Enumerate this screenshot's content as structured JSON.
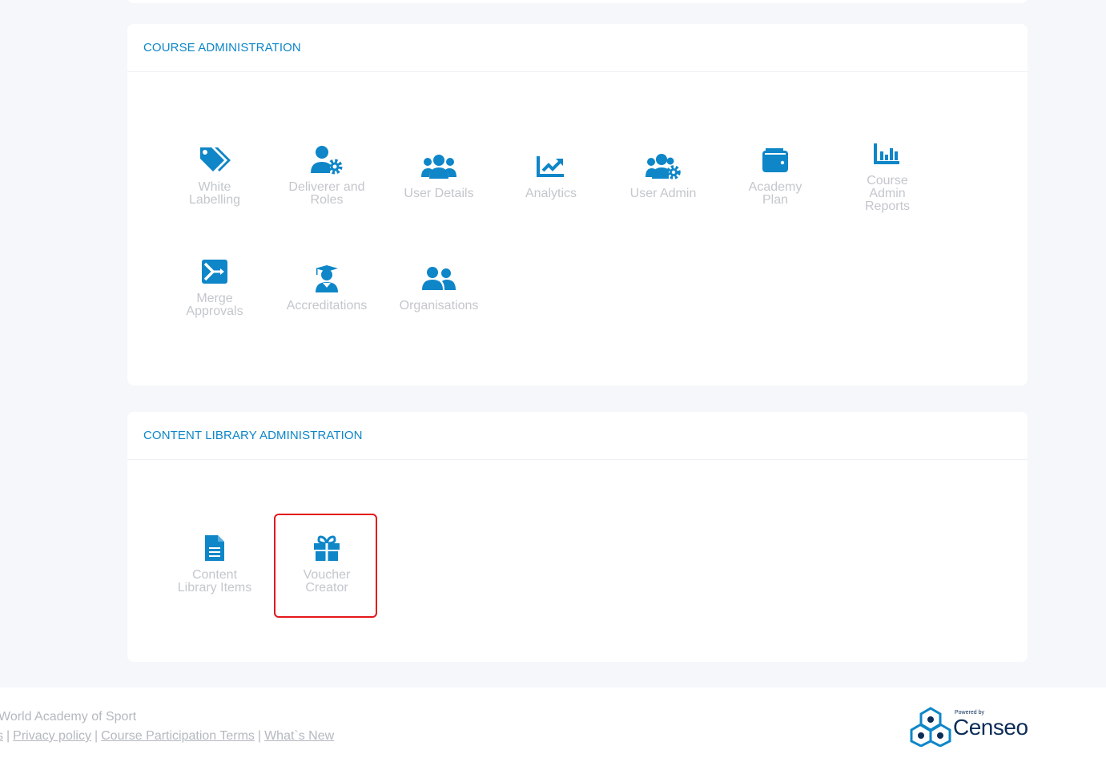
{
  "sections": [
    {
      "title": "COURSE ADMINISTRATION",
      "tiles": [
        {
          "label": "White\nLabelling",
          "icon": "tags-icon"
        },
        {
          "label": "Deliverer and\nRoles",
          "icon": "user-cog-icon"
        },
        {
          "label": "User Details",
          "icon": "users-icon"
        },
        {
          "label": "Analytics",
          "icon": "chart-line-icon"
        },
        {
          "label": "User Admin",
          "icon": "users-cog-icon"
        },
        {
          "label": "Academy\nPlan",
          "icon": "wallet-icon"
        },
        {
          "label": "Course\nAdmin\nReports",
          "icon": "chart-bar-icon"
        },
        {
          "label": "Merge\nApprovals",
          "icon": "merge-icon"
        },
        {
          "label": "Accreditations",
          "icon": "user-graduate-icon"
        },
        {
          "label": "Organisations",
          "icon": "user-friends-icon"
        }
      ]
    },
    {
      "title": "CONTENT LIBRARY ADMINISTRATION",
      "tiles": [
        {
          "label": "Content\nLibrary Items",
          "icon": "file-alt-icon"
        },
        {
          "label": "Voucher\nCreator",
          "icon": "gift-icon",
          "highlighted": true
        }
      ]
    }
  ],
  "footer": {
    "org": "World Academy of Sport",
    "links": [
      "s",
      "Privacy policy",
      "Course Participation Terms",
      "What`s New"
    ],
    "separator": "|",
    "powered_by": "Powered by",
    "brand": "Censeo"
  },
  "colors": {
    "accent": "#0e86c8",
    "label": "#c3c7cc",
    "highlight": "#e3161b",
    "brand": "#0c2d57"
  }
}
